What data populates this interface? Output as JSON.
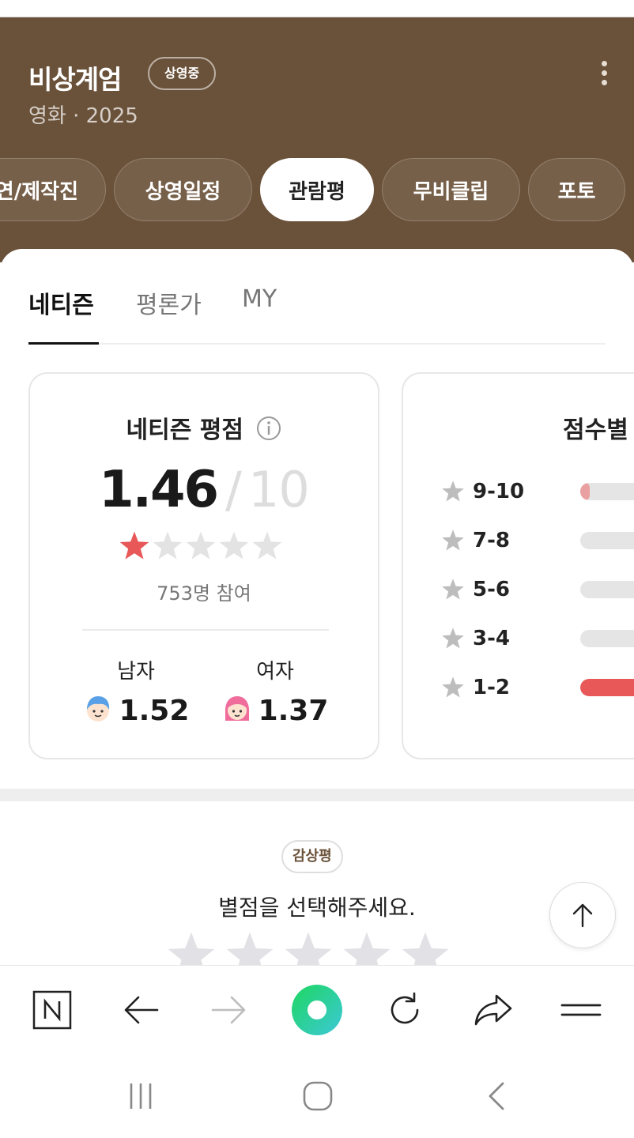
{
  "header": {
    "title": "비상계엄",
    "status_badge": "상영중",
    "meta": "영화 · 2025",
    "menu_icon": "more-vertical-icon",
    "background_color": "#6a5139"
  },
  "tabs": [
    {
      "label": "출연/제작진",
      "active": false
    },
    {
      "label": "상영일정",
      "active": false
    },
    {
      "label": "관람평",
      "active": true
    },
    {
      "label": "무비클립",
      "active": false
    },
    {
      "label": "포토",
      "active": false
    }
  ],
  "subtabs": [
    {
      "label": "네티즌",
      "active": true
    },
    {
      "label": "평론가",
      "active": false
    },
    {
      "label": "MY",
      "active": false
    }
  ],
  "rating_card": {
    "title": "네티즌 평점",
    "info_icon": "info-icon",
    "score": "1.46",
    "separator": "/",
    "max_score": "10",
    "stars_filled_fraction": 0.146,
    "participants": "753명 참여",
    "male": {
      "label": "남자",
      "score": "1.52",
      "icon": "male-avatar-icon"
    },
    "female": {
      "label": "여자",
      "score": "1.37",
      "icon": "female-avatar-icon"
    }
  },
  "distribution_card": {
    "title": "점수별",
    "rows": [
      {
        "label": "9-10",
        "fraction": 0.02,
        "color": "#e8a0a0"
      },
      {
        "label": "7-8",
        "fraction": 0.0,
        "color": "#e5e5e5"
      },
      {
        "label": "5-6",
        "fraction": 0.0,
        "color": "#e5e5e5"
      },
      {
        "label": "3-4",
        "fraction": 0.0,
        "color": "#e5e5e5"
      },
      {
        "label": "1-2",
        "fraction": 0.95,
        "color": "#e85858"
      }
    ]
  },
  "review": {
    "badge": "감상평",
    "prompt": "별점을 선택해주세요.",
    "star_count": 5
  },
  "toolbar": {
    "icons": [
      "naver-home-icon",
      "back-arrow-icon",
      "forward-arrow-icon",
      "green-dot-icon",
      "reload-icon",
      "share-icon",
      "menu-icon"
    ]
  },
  "navbar": {
    "icons": [
      "recent-apps-icon",
      "home-icon",
      "back-icon"
    ]
  },
  "colors": {
    "accent_red": "#e85858",
    "brand_brown": "#6a5139",
    "green": "#3ddc84"
  }
}
